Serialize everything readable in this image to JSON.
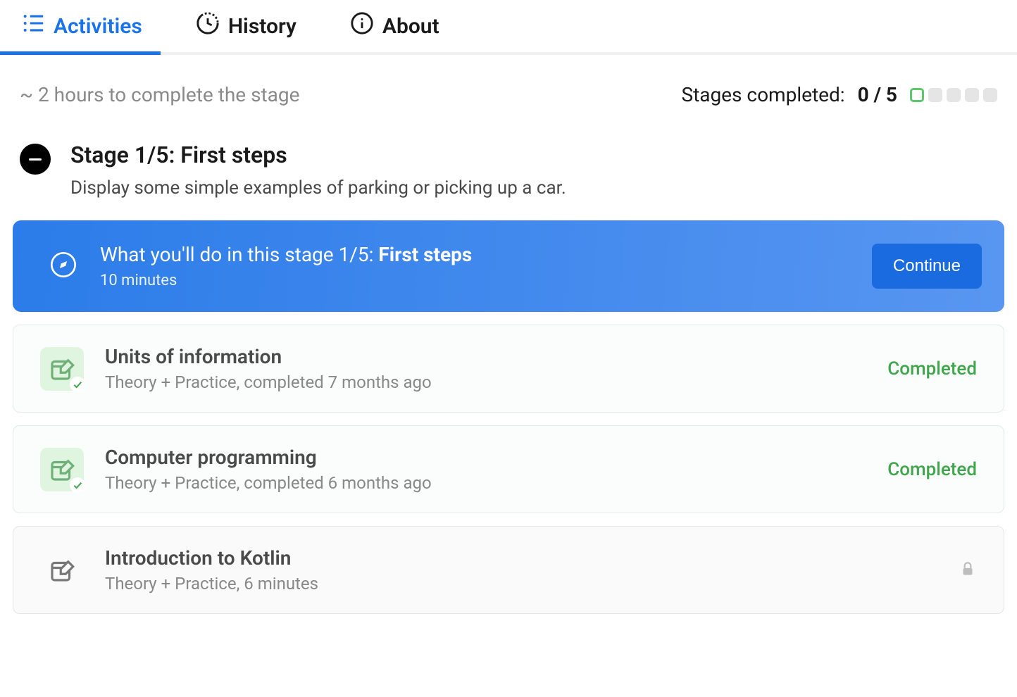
{
  "tabs": {
    "activities": "Activities",
    "history": "History",
    "about": "About"
  },
  "summary": {
    "estimate": "~ 2 hours to complete the stage",
    "completed_label": "Stages completed:",
    "completed_value": "0 / 5",
    "total_stages": 5,
    "current_stage_index": 0
  },
  "stage": {
    "title": "Stage 1/5: First steps",
    "description": "Display some simple examples of parking or picking up a car."
  },
  "hero": {
    "prefix": "What you'll do in this stage 1/5: ",
    "bold": "First steps",
    "subtitle": "10 minutes",
    "button": "Continue"
  },
  "lessons": [
    {
      "title": "Units of information",
      "subtitle": "Theory + Practice, completed 7 months ago",
      "status": "Completed",
      "state": "completed"
    },
    {
      "title": "Computer programming",
      "subtitle": "Theory + Practice, completed 6 months ago",
      "status": "Completed",
      "state": "completed"
    },
    {
      "title": "Introduction to Kotlin",
      "subtitle": "Theory + Practice, 6 minutes",
      "status": "",
      "state": "locked"
    }
  ],
  "colors": {
    "accent": "#1a73e8",
    "green": "#3fa64b"
  }
}
